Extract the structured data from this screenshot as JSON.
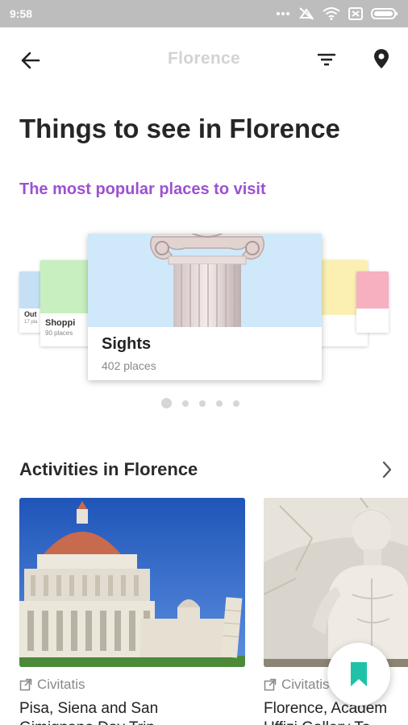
{
  "status_bar": {
    "time": "9:58"
  },
  "app_bar": {
    "title": "Florence"
  },
  "header": {
    "title": "Things to see in Florence",
    "subtitle": "The most popular places to visit"
  },
  "carousel": {
    "main": {
      "name": "Sights",
      "count": "402 places"
    },
    "left_cards": [
      {
        "name": "Shoppi",
        "count": "90 places",
        "color": "#c8efc0"
      },
      {
        "name": "Out",
        "count": "17 pla",
        "color": "#c5e0f5"
      }
    ],
    "right_cards": [
      {
        "color": "#fbf0b2"
      },
      {
        "color": "#f7b0c0"
      }
    ],
    "page_count": 5,
    "active_page": 1
  },
  "activities": {
    "title": "Activities in Florence",
    "items": [
      {
        "provider": "Civitatis",
        "title": "Pisa, Siena and San",
        "subtitle": "Gimignano Day Trip"
      },
      {
        "provider": "Civitatis",
        "title": "Florence, Academ",
        "subtitle": "Uffizi Gallery To"
      }
    ]
  },
  "colors": {
    "accent": "#9b51d0",
    "fab_icon": "#1fc2a8",
    "status_bar": "#bdbdbd"
  }
}
